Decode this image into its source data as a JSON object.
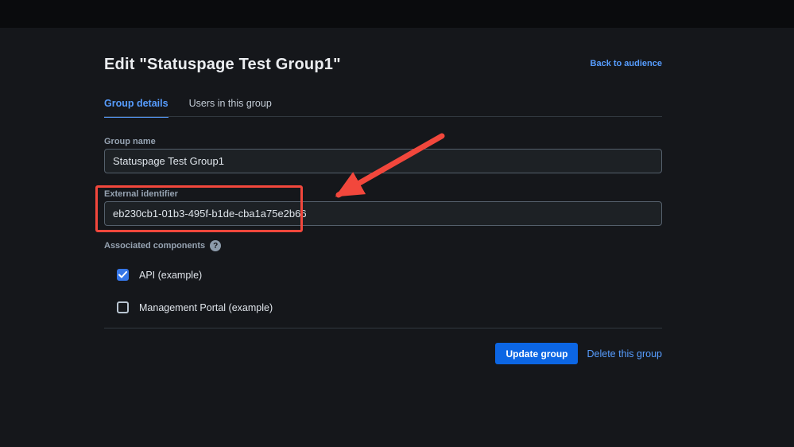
{
  "page": {
    "title": "Edit \"Statuspage Test Group1\"",
    "back_link": "Back to audience"
  },
  "tabs": [
    {
      "label": "Group details",
      "active": true
    },
    {
      "label": "Users in this group",
      "active": false
    }
  ],
  "form": {
    "group_name": {
      "label": "Group name",
      "value": "Statuspage Test Group1"
    },
    "external_identifier": {
      "label": "External identifier",
      "value": "eb230cb1-01b3-495f-b1de-cba1a75e2b66"
    },
    "associated_components": {
      "label": "Associated components",
      "help_icon": "?",
      "options": [
        {
          "label": "API (example)",
          "checked": true
        },
        {
          "label": "Management Portal (example)",
          "checked": false
        }
      ]
    }
  },
  "actions": {
    "update_label": "Update group",
    "delete_label": "Delete this group"
  },
  "annotation": {
    "color": "#f2473c",
    "type": "highlight-box-with-arrow"
  },
  "colors": {
    "accent_blue": "#579dff",
    "button_blue": "#0c66e4",
    "checkbox_blue": "#3576e8",
    "background": "#15171b",
    "input_background": "#1d2125"
  }
}
